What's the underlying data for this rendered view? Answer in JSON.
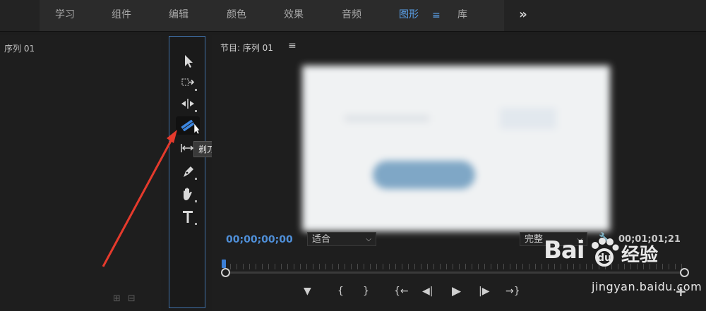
{
  "workspaces": {
    "items": [
      {
        "label": "学习"
      },
      {
        "label": "组件"
      },
      {
        "label": "编辑"
      },
      {
        "label": "颜色"
      },
      {
        "label": "效果"
      },
      {
        "label": "音频"
      },
      {
        "label": "图形"
      },
      {
        "label": "库"
      }
    ],
    "active": "图形",
    "menu_glyph": "≡",
    "overflow_glyph": "»"
  },
  "source_panel": {
    "title": "序列 01",
    "footer_icons": [
      "export-frame-icon",
      "insert-icon"
    ]
  },
  "tools_panel": {
    "tools": [
      {
        "name": "selection-tool-icon"
      },
      {
        "name": "track-select-tool-icon"
      },
      {
        "name": "ripple-edit-tool-icon"
      },
      {
        "name": "razor-tool-icon"
      },
      {
        "name": "slip-tool-icon"
      },
      {
        "name": "pen-tool-icon"
      },
      {
        "name": "hand-tool-icon"
      },
      {
        "name": "type-tool-icon"
      }
    ],
    "selected": "razor-tool-icon",
    "tooltip": "剃刀工具 (C)"
  },
  "program_monitor": {
    "title": "节目: 序列 01",
    "menu_glyph": "≡",
    "timecode_current": "00;00;00;00",
    "fit_dropdown": "适合",
    "quality_dropdown": "完整",
    "timecode_duration": "00;01;01;21",
    "transport_buttons": [
      {
        "name": "add-marker-icon",
        "glyph": "▼"
      },
      {
        "name": "mark-in-icon",
        "glyph": "{"
      },
      {
        "name": "mark-out-icon",
        "glyph": "}"
      },
      {
        "name": "go-to-in-icon",
        "glyph": "{←"
      },
      {
        "name": "step-back-icon",
        "glyph": "◀|"
      },
      {
        "name": "play-icon",
        "glyph": "▶"
      },
      {
        "name": "step-forward-icon",
        "glyph": "|▶"
      },
      {
        "name": "go-to-out-icon",
        "glyph": "→}"
      },
      {
        "name": "add-button-icon",
        "glyph": "+"
      }
    ]
  },
  "watermark": {
    "brand": "Bai",
    "brand2": "经验",
    "url": "jingyan.baidu.com"
  },
  "colors": {
    "accent": "#5aa0e8",
    "panel_border": "#3f6fa6",
    "arrow": "#e53a2c"
  }
}
